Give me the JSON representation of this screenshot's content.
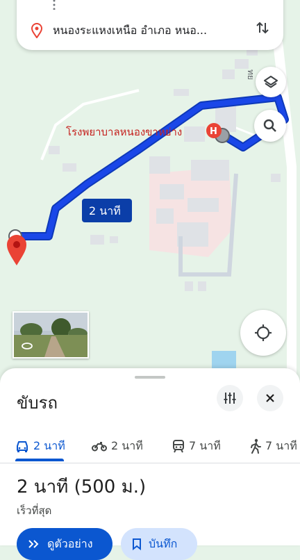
{
  "search": {
    "destination": "หนองระแหงเหนือ อำเภอ หนอ..."
  },
  "map": {
    "poi_hospital": "โรงพยาบาลหนองขาหย่าง",
    "road_fragment": "ทย",
    "route_duration_label": "2 นาที",
    "route_color": "#1a47e8",
    "pin_color": "#ea4335",
    "hospital_icon_color": "#ea4335"
  },
  "sheet": {
    "title": "ขับรถ",
    "modes": [
      {
        "icon": "car-icon",
        "label": "2 นาที"
      },
      {
        "icon": "motorbike-icon",
        "label": "2 นาที"
      },
      {
        "icon": "transit-icon",
        "label": "7 นาที"
      },
      {
        "icon": "walk-icon",
        "label": "7 นาที"
      }
    ],
    "summary": "2 นาที (500 ม.)",
    "subtext": "เร็วที่สุด",
    "start_button": "ดูตัวอย่าง",
    "save_button": "บันทึก",
    "accent_color": "#0b57d0"
  }
}
